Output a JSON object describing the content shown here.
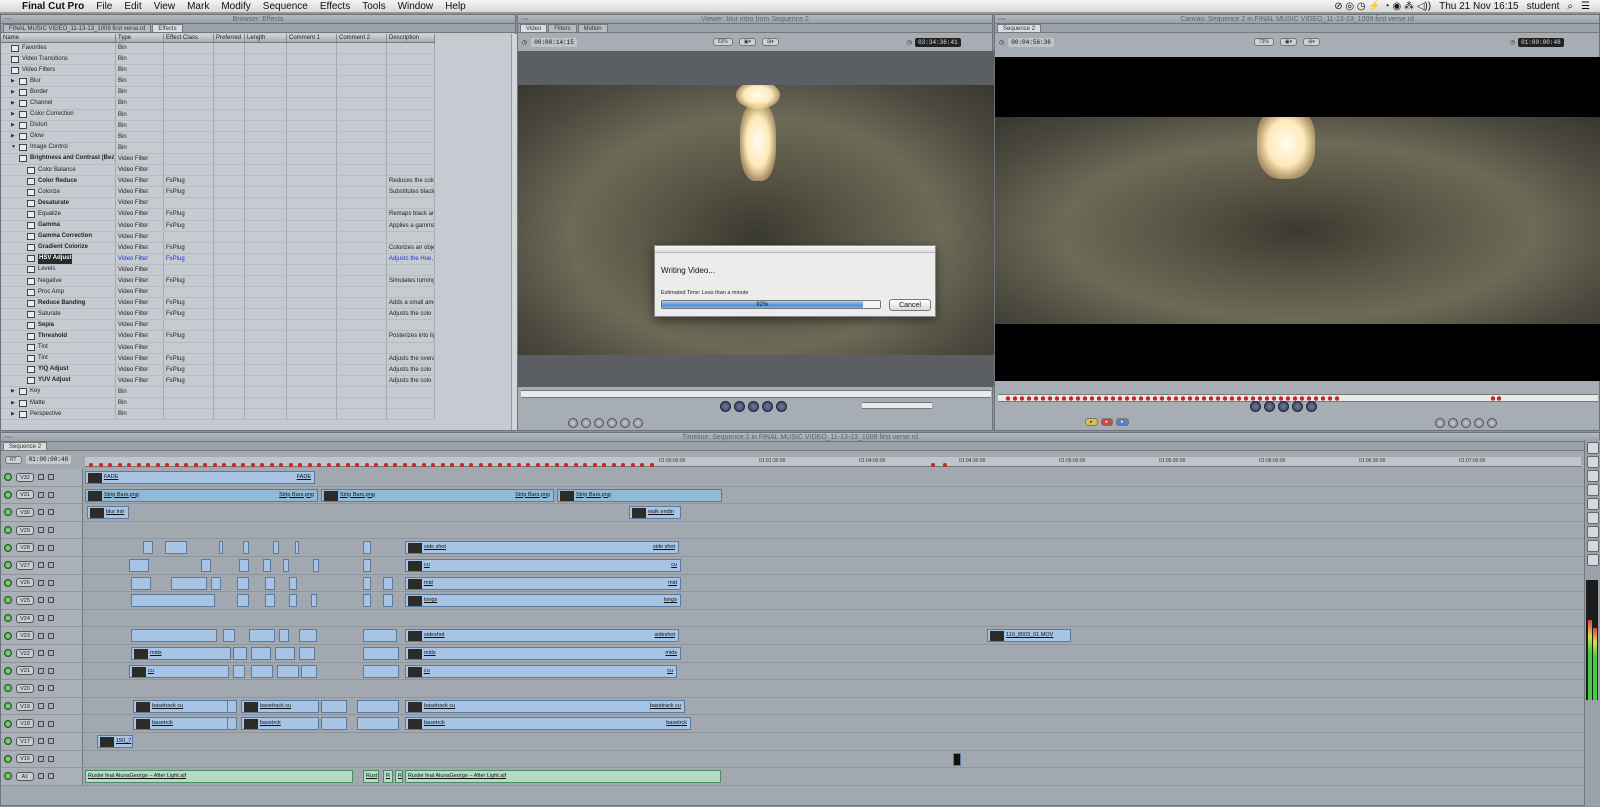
{
  "menubar": {
    "app_name": "Final Cut Pro",
    "items": [
      "File",
      "Edit",
      "View",
      "Mark",
      "Modify",
      "Sequence",
      "Effects",
      "Tools",
      "Window",
      "Help"
    ],
    "clock": "Thu 21 Nov  16:15",
    "user": "student"
  },
  "browser": {
    "title": "Browser: Effects",
    "tabs": [
      "FINAL MUSIC VIDEO_11-13-13_1009 first verse.rd",
      "Effects"
    ],
    "columns": [
      "Name",
      "Type",
      "Effect Class",
      "Preferred",
      "Length",
      "Comment 1",
      "Comment 2",
      "Description"
    ],
    "rows": [
      {
        "name": "Favorites",
        "type": "Bin",
        "cls": "",
        "desc": "",
        "indent": 0,
        "tri": ""
      },
      {
        "name": "Video Transitions",
        "type": "Bin",
        "cls": "",
        "desc": "",
        "indent": 0,
        "tri": ""
      },
      {
        "name": "Video Filters",
        "type": "Bin",
        "cls": "",
        "desc": "",
        "indent": 0,
        "tri": ""
      },
      {
        "name": "Blur",
        "type": "Bin",
        "cls": "",
        "desc": "",
        "indent": 1,
        "tri": "▶"
      },
      {
        "name": "Border",
        "type": "Bin",
        "cls": "",
        "desc": "",
        "indent": 1,
        "tri": "▶"
      },
      {
        "name": "Channel",
        "type": "Bin",
        "cls": "",
        "desc": "",
        "indent": 1,
        "tri": "▶"
      },
      {
        "name": "Color Correction",
        "type": "Bin",
        "cls": "",
        "desc": "",
        "indent": 1,
        "tri": "▶"
      },
      {
        "name": "Distort",
        "type": "Bin",
        "cls": "",
        "desc": "",
        "indent": 1,
        "tri": "▶"
      },
      {
        "name": "Glow",
        "type": "Bin",
        "cls": "",
        "desc": "",
        "indent": 1,
        "tri": "▶"
      },
      {
        "name": "Image Control",
        "type": "Bin",
        "cls": "",
        "desc": "",
        "indent": 1,
        "tri": "▼"
      },
      {
        "name": "Brightness and Contrast (Bez)",
        "type": "Video Filter",
        "cls": "",
        "desc": "",
        "indent": 2,
        "tri": ""
      },
      {
        "name": "Color Balance",
        "type": "Video Filter",
        "cls": "",
        "desc": "",
        "indent": 2,
        "tri": ""
      },
      {
        "name": "Color Reduce",
        "type": "Video Filter",
        "cls": "FxPlug",
        "desc": "Reduces the colo",
        "indent": 2,
        "tri": ""
      },
      {
        "name": "Colorize",
        "type": "Video Filter",
        "cls": "FxPlug",
        "desc": "Substitutes black",
        "indent": 2,
        "tri": ""
      },
      {
        "name": "Desaturate",
        "type": "Video Filter",
        "cls": "",
        "desc": "",
        "indent": 2,
        "tri": ""
      },
      {
        "name": "Equalize",
        "type": "Video Filter",
        "cls": "FxPlug",
        "desc": "Remaps black an",
        "indent": 2,
        "tri": ""
      },
      {
        "name": "Gamma",
        "type": "Video Filter",
        "cls": "FxPlug",
        "desc": "Applies a gamma",
        "indent": 2,
        "tri": ""
      },
      {
        "name": "Gamma Correction",
        "type": "Video Filter",
        "cls": "",
        "desc": "",
        "indent": 2,
        "tri": ""
      },
      {
        "name": "Gradient Colorize",
        "type": "Video Filter",
        "cls": "FxPlug",
        "desc": "Colorizes an obje",
        "indent": 2,
        "tri": ""
      },
      {
        "name": "HSV Adjust",
        "type": "Video Filter",
        "cls": "FxPlug",
        "desc": "Adjusts the Hue,",
        "indent": 2,
        "tri": "",
        "selected": true
      },
      {
        "name": "Levels",
        "type": "Video Filter",
        "cls": "",
        "desc": "",
        "indent": 2,
        "tri": ""
      },
      {
        "name": "Negative",
        "type": "Video Filter",
        "cls": "FxPlug",
        "desc": "Simulates turning",
        "indent": 2,
        "tri": ""
      },
      {
        "name": "Proc Amp",
        "type": "Video Filter",
        "cls": "",
        "desc": "",
        "indent": 2,
        "tri": ""
      },
      {
        "name": "Reduce Banding",
        "type": "Video Filter",
        "cls": "FxPlug",
        "desc": "Adds a small amo",
        "indent": 2,
        "tri": ""
      },
      {
        "name": "Saturate",
        "type": "Video Filter",
        "cls": "FxPlug",
        "desc": "Adjusts the colo",
        "indent": 2,
        "tri": ""
      },
      {
        "name": "Sepia",
        "type": "Video Filter",
        "cls": "",
        "desc": "",
        "indent": 2,
        "tri": ""
      },
      {
        "name": "Threshold",
        "type": "Video Filter",
        "cls": "FxPlug",
        "desc": "Posterizes into lig",
        "indent": 2,
        "tri": ""
      },
      {
        "name": "Tint",
        "type": "Video Filter",
        "cls": "",
        "desc": "",
        "indent": 2,
        "tri": ""
      },
      {
        "name": "Tint",
        "type": "Video Filter",
        "cls": "FxPlug",
        "desc": "Adjusts the overa",
        "indent": 2,
        "tri": ""
      },
      {
        "name": "YIQ Adjust",
        "type": "Video Filter",
        "cls": "FxPlug",
        "desc": "Adjusts the colo",
        "indent": 2,
        "tri": ""
      },
      {
        "name": "YUV Adjust",
        "type": "Video Filter",
        "cls": "FxPlug",
        "desc": "Adjusts the colo",
        "indent": 2,
        "tri": ""
      },
      {
        "name": "Key",
        "type": "Bin",
        "cls": "",
        "desc": "",
        "indent": 1,
        "tri": "▶"
      },
      {
        "name": "Matte",
        "type": "Bin",
        "cls": "",
        "desc": "",
        "indent": 1,
        "tri": "▶"
      },
      {
        "name": "Perspective",
        "type": "Bin",
        "cls": "",
        "desc": "",
        "indent": 1,
        "tri": "▶"
      }
    ]
  },
  "viewer": {
    "title": "Viewer: blur intro from Sequence 2",
    "tabs": [
      "Video",
      "Filters",
      "Motion"
    ],
    "timecode_left": "00:00:14:15",
    "zoom": "63%",
    "timecode_right": "03:34:36:41"
  },
  "canvas": {
    "title": "Canvas: Sequence 2 in FINAL MUSIC VIDEO_11-13-13_1009 first verse rd",
    "tab": "Sequence 2",
    "timecode_left": "00:04:56:36",
    "zoom": "73%",
    "timecode_right": "01:00:00:48"
  },
  "dialog": {
    "title": "Writing Video...",
    "estimate": "Estimated Time: Less than a minute",
    "progress_label": "92%",
    "progress": 0.92,
    "cancel": "Cancel"
  },
  "timeline": {
    "title": "Timeline: Sequence 2 in FINAL MUSIC VIDEO_11-13-13_1009 first verse rd",
    "tab": "Sequence 2",
    "rt": "RT",
    "timecode": "01:00:00:48",
    "ruler": [
      "01:00:00:00",
      "01:01:30:00",
      "01:04:00:00",
      "01:04:30:00",
      "01:05:00:00",
      "01:05:30:00",
      "01:06:00:00",
      "01:06:30:00",
      "01:07:00:00"
    ],
    "tracks": [
      "V32",
      "V31",
      "V30",
      "V29",
      "V28",
      "V27",
      "V26",
      "V25",
      "V24",
      "V23",
      "V22",
      "V21",
      "V20",
      "V19",
      "V18",
      "V17",
      "V16",
      "A1"
    ],
    "clips": {
      "fade_l": "FADE",
      "fade_r": "FADE",
      "strip": "Strip Bars.png",
      "blur": "blur intr",
      "walk": "walk endin",
      "side_shot": "side shot",
      "cu": "cu",
      "mid": "mid",
      "longs": "longs",
      "sideshot": "sideshot",
      "mids": "mids",
      "mov": "110_8003_01.MOV",
      "basetrack_cu": "basetrack cu",
      "basetrck": "basetrck",
      "v17": "150_7",
      "audio": "Rustie feat AlunaGeorge – After Light.aif",
      "audio_short1": "Rust",
      "audio_short2": "R",
      "audio_short3": "R"
    }
  },
  "colors": {
    "clip_video": "#a8c4e4",
    "clip_audio": "#b5dcc3",
    "marker": "#cc2222",
    "track_on": "#2f8a2f"
  }
}
